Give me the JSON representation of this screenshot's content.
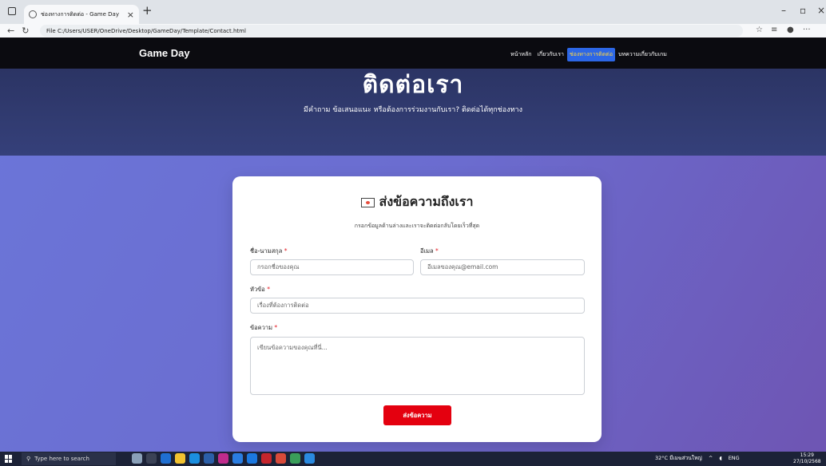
{
  "browser": {
    "tab_title": "ช่องทางการติดต่อ - Game Day",
    "url": "File   C:/Users/USER/OneDrive/Desktop/GameDay/Template/Contact.html"
  },
  "navbar": {
    "brand": "Game Day",
    "links": [
      "หน้าหลัก",
      "เกี่ยวกับเรา",
      "ช่องทางการติดต่อ",
      "บทความเกี่ยวกับเกม"
    ],
    "active_index": 2
  },
  "hero": {
    "title": "ติดต่อเรา",
    "subtitle": "มีคำถาม ข้อเสนอแนะ หรือต้องการร่วมงานกับเรา? ติดต่อได้ทุกช่องทาง"
  },
  "form": {
    "title": "ส่งข้อความถึงเรา",
    "subtitle": "กรอกข้อมูลด้านล่างและเราจะติดต่อกลับโดยเร็วที่สุด",
    "name_label": "ชื่อ-นามสกุล",
    "name_placeholder": "กรอกชื่อของคุณ",
    "email_label": "อีเมล",
    "email_placeholder": "อีเมลของคุณ@email.com",
    "subject_label": "หัวข้อ",
    "subject_placeholder": "เรื่องที่ต้องการติดต่อ",
    "message_label": "ข้อความ",
    "message_placeholder": "เขียนข้อความของคุณที่นี่...",
    "required_mark": "*",
    "submit_label": "ส่งข้อความ"
  },
  "taskbar": {
    "search_placeholder": "Type here to search",
    "weather": "32°C มีเมฆส่วนใหญ่",
    "lang": "ENG",
    "time": "15:29",
    "date": "27/10/2568"
  },
  "colors": {
    "accent": "#2d67e6",
    "submit": "#e4000f",
    "navbar": "#0b0b10"
  }
}
